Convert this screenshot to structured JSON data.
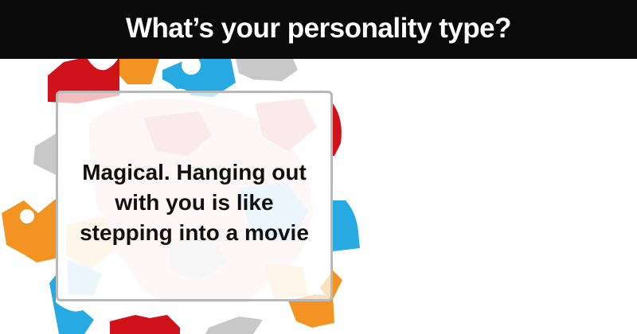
{
  "header": {
    "title": "What’s your personality type?"
  },
  "result": {
    "text": "Magical. Hanging out with you is like stepping into a movie"
  },
  "illustration": {
    "subject": "head silhouette made of puzzle pieces",
    "colors": {
      "red": "#d0121b",
      "orange": "#f39321",
      "blue": "#27a9e1",
      "gray": "#c8c8c8",
      "header": "#0a0a0a"
    }
  }
}
